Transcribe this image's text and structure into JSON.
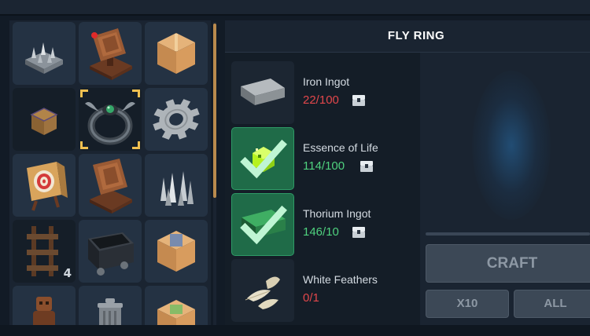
{
  "title": "FLY RING",
  "inventory": {
    "slots": [
      {
        "icon": "spiked-trap-icon"
      },
      {
        "icon": "pressure-plate-icon",
        "badge": "red-dot"
      },
      {
        "icon": "crate-icon"
      },
      {
        "icon": "small-crate-icon"
      },
      {
        "icon": "fly-ring-icon",
        "selected": true
      },
      {
        "icon": "gear-icon"
      },
      {
        "icon": "archery-target-icon"
      },
      {
        "icon": "pressure-plate-icon"
      },
      {
        "icon": "floor-spikes-icon"
      },
      {
        "icon": "rail-track-icon",
        "count": "4"
      },
      {
        "icon": "minecart-icon"
      },
      {
        "icon": "crate-icon"
      },
      {
        "icon": "wooden-figure-icon"
      },
      {
        "icon": "trash-can-icon"
      },
      {
        "icon": "crate-icon"
      }
    ]
  },
  "requirements": [
    {
      "name": "Iron Ingot",
      "amount": "22/100",
      "status": "insufficient",
      "icon": "iron-ingot-icon"
    },
    {
      "name": "Essence of Life",
      "amount": "114/100",
      "status": "satisfied",
      "icon": "essence-of-life-icon"
    },
    {
      "name": "Thorium Ingot",
      "amount": "146/10",
      "status": "satisfied",
      "icon": "thorium-ingot-icon"
    },
    {
      "name": "White Feathers",
      "amount": "0/1",
      "status": "insufficient",
      "icon": "white-feathers-icon"
    }
  ],
  "actions": {
    "craft": "CRAFT",
    "x10": "X10",
    "all": "ALL"
  },
  "colors": {
    "insufficient": "#e2474b",
    "satisfied": "#4fd17e",
    "accent": "#f0c050"
  }
}
